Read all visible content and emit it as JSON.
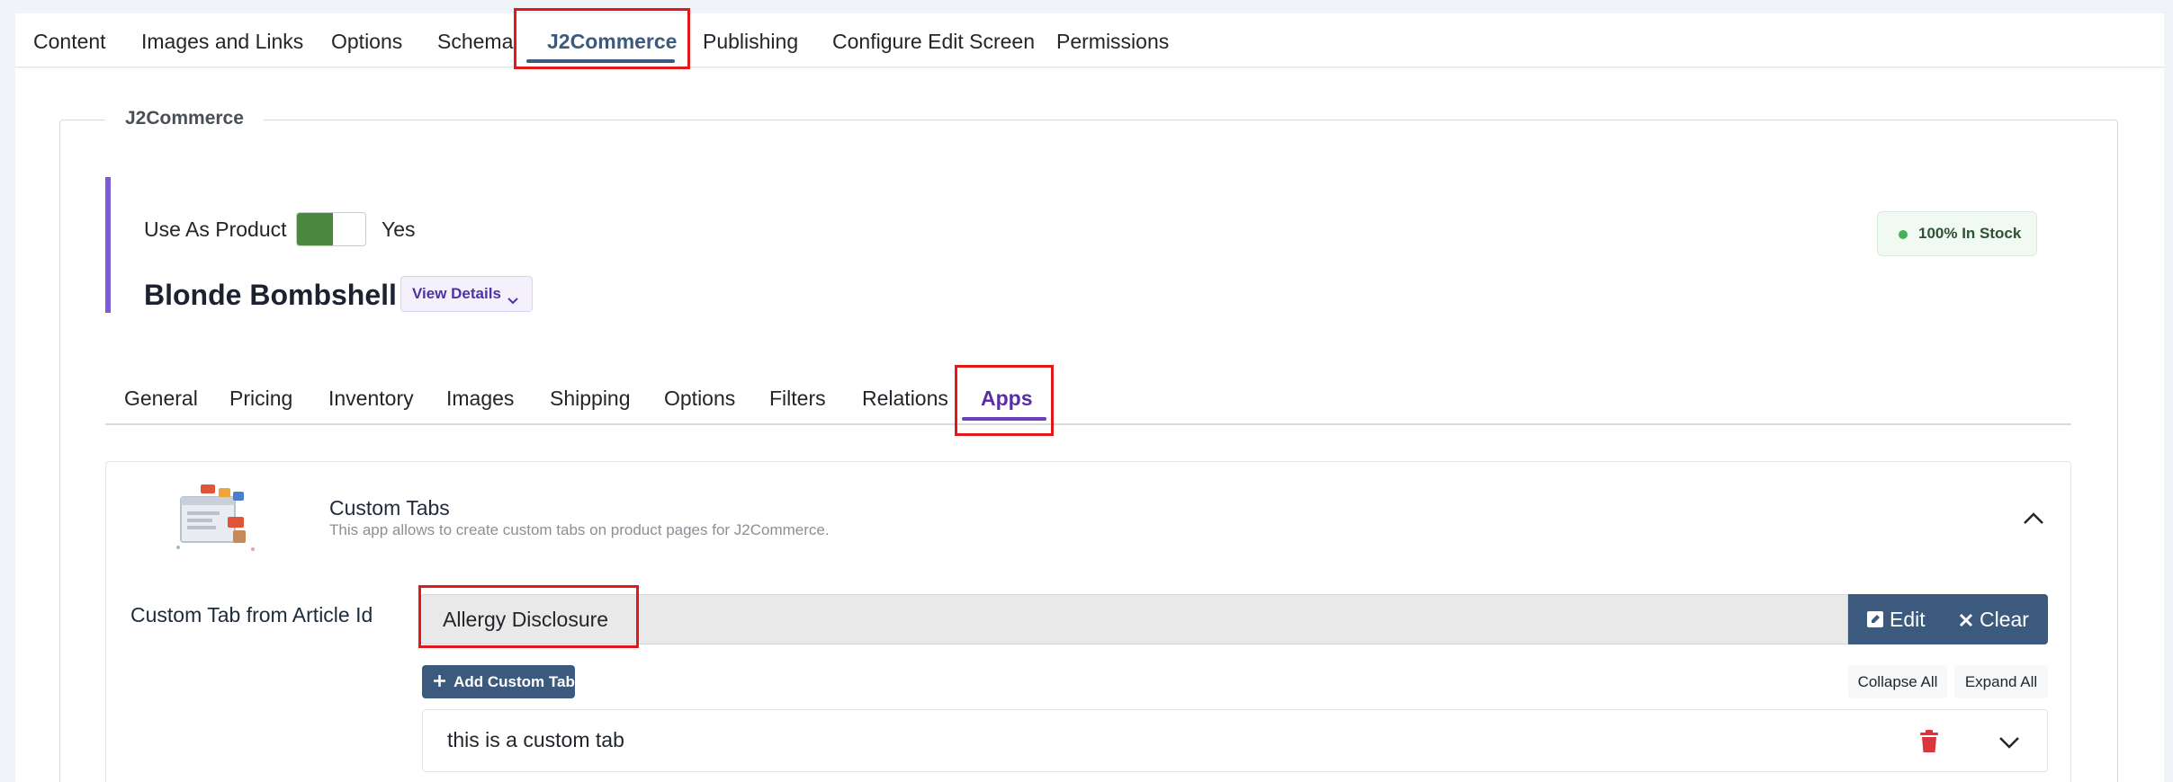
{
  "main_tabs": [
    {
      "label": "Content"
    },
    {
      "label": "Images and Links"
    },
    {
      "label": "Options"
    },
    {
      "label": "Schema"
    },
    {
      "label": "J2Commerce",
      "active": true
    },
    {
      "label": "Publishing"
    },
    {
      "label": "Configure Edit Screen"
    },
    {
      "label": "Permissions"
    }
  ],
  "fieldset": {
    "legend": "J2Commerce"
  },
  "product": {
    "use_as_product_label": "Use As Product",
    "use_as_product_value": "Yes",
    "name": "Blonde Bombshell",
    "view_details_label": "View Details",
    "stock_label": "100% In Stock"
  },
  "sub_tabs": [
    {
      "label": "General"
    },
    {
      "label": "Pricing"
    },
    {
      "label": "Inventory"
    },
    {
      "label": "Images"
    },
    {
      "label": "Shipping"
    },
    {
      "label": "Options"
    },
    {
      "label": "Filters"
    },
    {
      "label": "Relations"
    },
    {
      "label": "Apps",
      "active": true
    }
  ],
  "app": {
    "title": "Custom Tabs",
    "description": "This app allows to create custom tabs on product pages for J2Commerce.",
    "field_label": "Custom Tab from Article Id",
    "article_value": "Allergy Disclosure",
    "edit_label": "Edit",
    "clear_label": "Clear",
    "add_tab_label": "Add Custom Tab",
    "collapse_all_label": "Collapse All",
    "expand_all_label": "Expand All",
    "custom_tabs": [
      {
        "title": "this is a custom tab"
      }
    ]
  },
  "colors": {
    "primary": "#3c5a7d",
    "accent_purple": "#6b3fc0",
    "toggle_on": "#4a873f",
    "stock_dot": "#45b056",
    "delete": "#d9363e",
    "highlight": "#e01919"
  }
}
